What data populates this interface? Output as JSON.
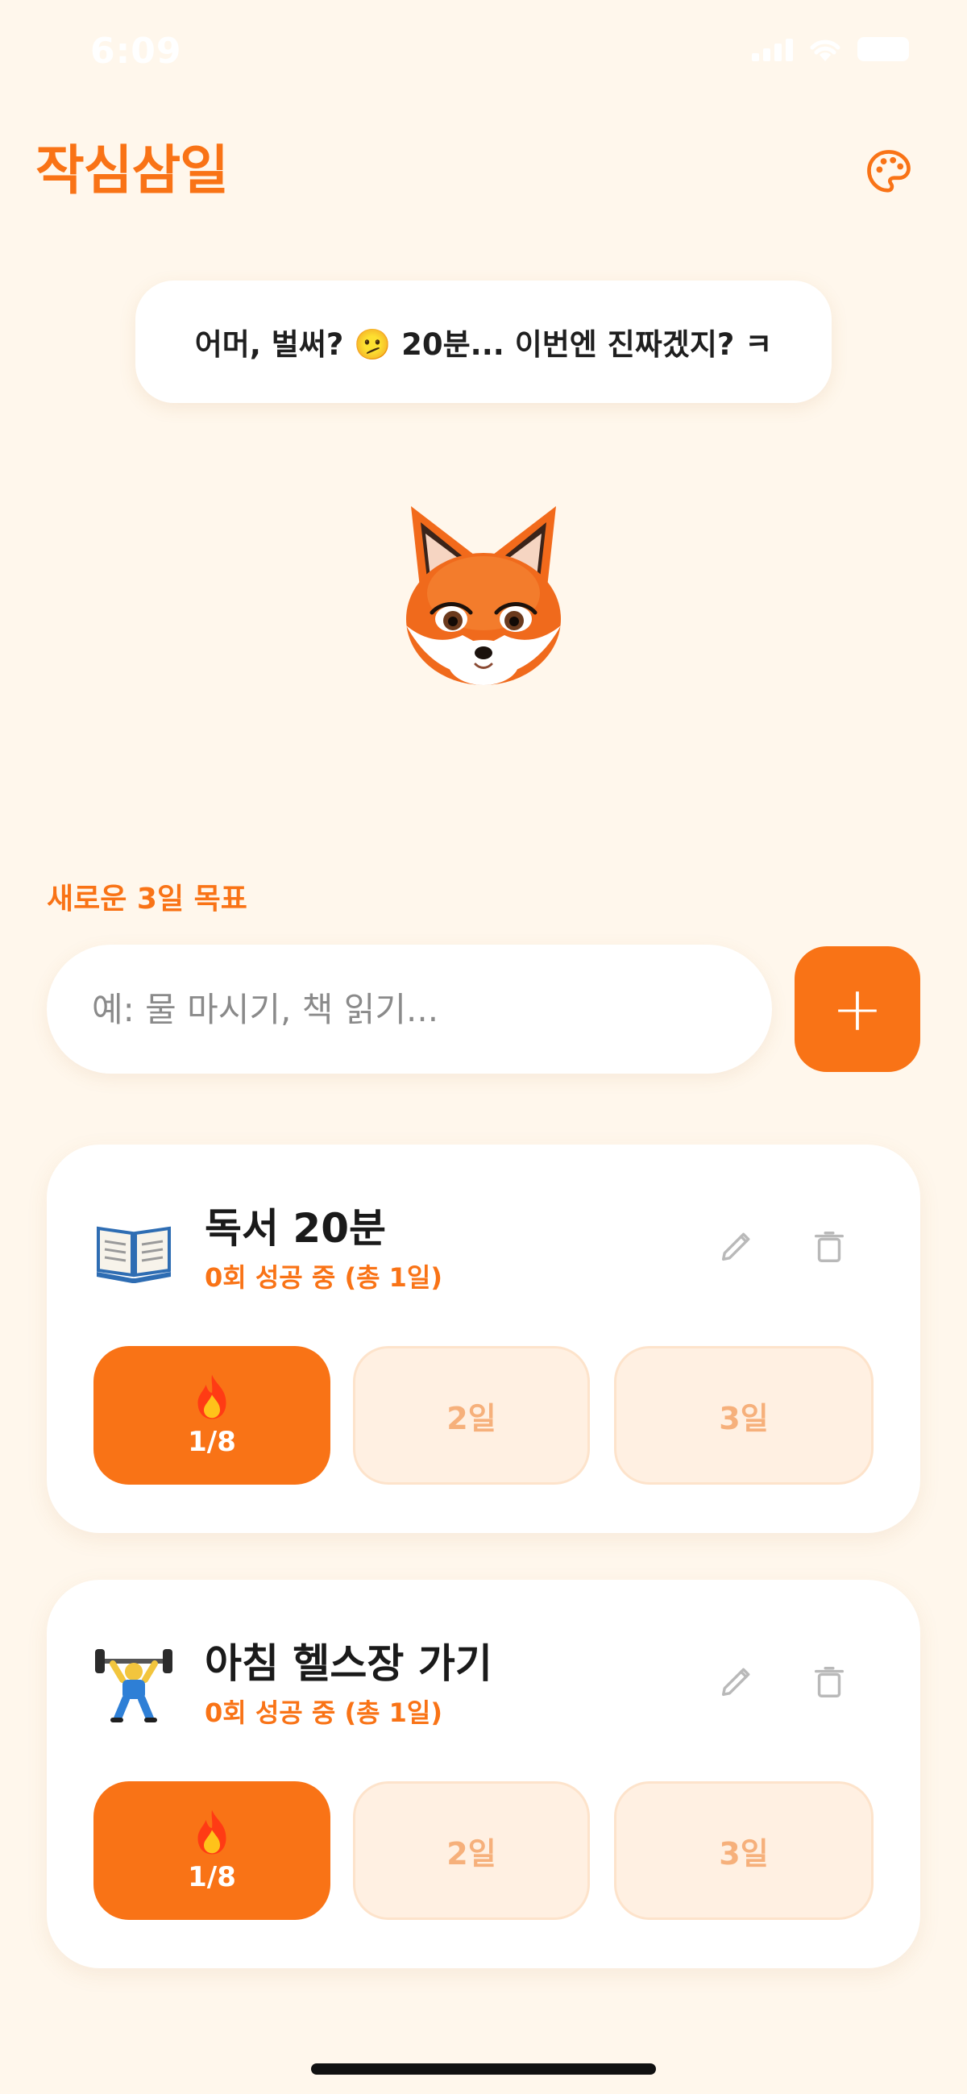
{
  "status_bar": {
    "time": "6:09"
  },
  "header": {
    "title": "작심삼일",
    "palette_icon": "palette-icon"
  },
  "bubble": {
    "message": "어머, 벌써? 🫤 20분... 이번엔 진짜겠지? ㅋ"
  },
  "mascot": {
    "icon": "fox-icon"
  },
  "new_goal": {
    "label": "새로운 3일 목표",
    "placeholder": "예: 물 마시기, 책 읽기...",
    "add_label": "+"
  },
  "goals": [
    {
      "icon": "book-icon",
      "title": "독서 20분",
      "subtitle": "0회 성공 중 (총 1일)",
      "day1_progress": "1/8",
      "day2_label": "2일",
      "day3_label": "3일"
    },
    {
      "icon": "weightlifter-icon",
      "title": "아침 헬스장 가기",
      "subtitle": "0회 성공 중 (총 1일)",
      "day1_progress": "1/8",
      "day2_label": "2일",
      "day3_label": "3일"
    }
  ],
  "colors": {
    "accent": "#f97316",
    "background": "#fff7ec",
    "pending_day": "#fff0e2"
  }
}
